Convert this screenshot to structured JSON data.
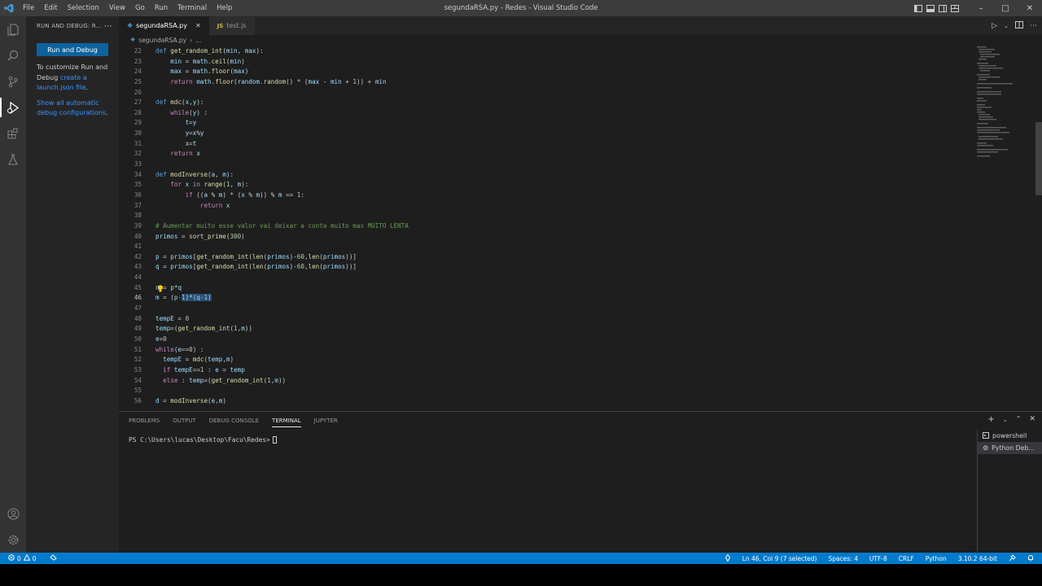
{
  "window": {
    "title": "segundaRSA.py - Redes - Visual Studio Code",
    "menu": [
      "File",
      "Edit",
      "Selection",
      "View",
      "Go",
      "Run",
      "Terminal",
      "Help"
    ]
  },
  "sidebar": {
    "header": "RUN AND DEBUG: R...",
    "run_button": "Run and Debug",
    "customize_prefix": "To customize Run and Debug ",
    "customize_link": "create a launch.json file",
    "customize_suffix": ".",
    "show_all_link": "Show all automatic debug configurations",
    "show_all_suffix": "."
  },
  "tabs": [
    {
      "label": "segundaRSA.py",
      "icon": "python-icon",
      "active": true
    },
    {
      "label": "test.js",
      "icon": "js-icon",
      "active": false
    }
  ],
  "breadcrumb": [
    "segundaRSA.py",
    "..."
  ],
  "code_lines": [
    {
      "n": "22",
      "t": "def get_random_int(min, max):"
    },
    {
      "n": "23",
      "t": "    min = math.ceil(min)"
    },
    {
      "n": "24",
      "t": "    max = math.floor(max)"
    },
    {
      "n": "25",
      "t": "    return math.floor(random.random() * (max - min + 1)) + min"
    },
    {
      "n": "26",
      "t": ""
    },
    {
      "n": "27",
      "t": "def mdc(x,y):"
    },
    {
      "n": "28",
      "t": "    while(y) :"
    },
    {
      "n": "29",
      "t": "        t=y"
    },
    {
      "n": "30",
      "t": "        y=x%y"
    },
    {
      "n": "31",
      "t": "        x=t"
    },
    {
      "n": "32",
      "t": "    return x"
    },
    {
      "n": "33",
      "t": ""
    },
    {
      "n": "34",
      "t": "def modInverse(a, m):"
    },
    {
      "n": "35",
      "t": "    for x in range(1, m):"
    },
    {
      "n": "36",
      "t": "        if ((a % m) * (x % m)) % m == 1:"
    },
    {
      "n": "37",
      "t": "            return x"
    },
    {
      "n": "38",
      "t": ""
    },
    {
      "n": "39",
      "t": "# Aumentar muito esse valor vai deixar a conta muito mas MUITO LENTA"
    },
    {
      "n": "40",
      "t": "primos = sort_prime(300)"
    },
    {
      "n": "41",
      "t": ""
    },
    {
      "n": "42",
      "t": "p = primos[get_random_int(len(primos)-60,len(primos))]"
    },
    {
      "n": "43",
      "t": "q = primos[get_random_int(len(primos)-60,len(primos))]"
    },
    {
      "n": "44",
      "t": ""
    },
    {
      "n": "45",
      "t": "n = p*q"
    },
    {
      "n": "46",
      "t": "m = (p-1)*(q-1)"
    },
    {
      "n": "47",
      "t": ""
    },
    {
      "n": "48",
      "t": "tempE = 0"
    },
    {
      "n": "49",
      "t": "temp=(get_random_int(1,m))"
    },
    {
      "n": "50",
      "t": "e=0"
    },
    {
      "n": "51",
      "t": "while(e==0) :"
    },
    {
      "n": "52",
      "t": "  tempE = mdc(temp,m)"
    },
    {
      "n": "53",
      "t": "  if tempE==1 : e = temp"
    },
    {
      "n": "54",
      "t": "  else : temp=(get_random_int(1,m))"
    },
    {
      "n": "55",
      "t": ""
    },
    {
      "n": "56",
      "t": "d = modInverse(e,m)"
    }
  ],
  "panel": {
    "tabs": [
      "PROBLEMS",
      "OUTPUT",
      "DEBUG CONSOLE",
      "TERMINAL",
      "JUPYTER"
    ],
    "active_tab": "TERMINAL",
    "prompt": "PS C:\\Users\\lucas\\Desktop\\Facu\\Redes>",
    "terminals": [
      "powershell",
      "Python Deb..."
    ]
  },
  "statusbar": {
    "errors": "0",
    "warnings": "0",
    "position": "Ln 46, Col 9 (7 selected)",
    "spaces": "Spaces: 4",
    "encoding": "UTF-8",
    "eol": "CRLF",
    "language": "Python",
    "interpreter": "3.10.2 64-bit"
  },
  "colors": {
    "accent": "#007acc",
    "button": "#0e639c",
    "link": "#3794ff",
    "selection": "#264f78"
  }
}
